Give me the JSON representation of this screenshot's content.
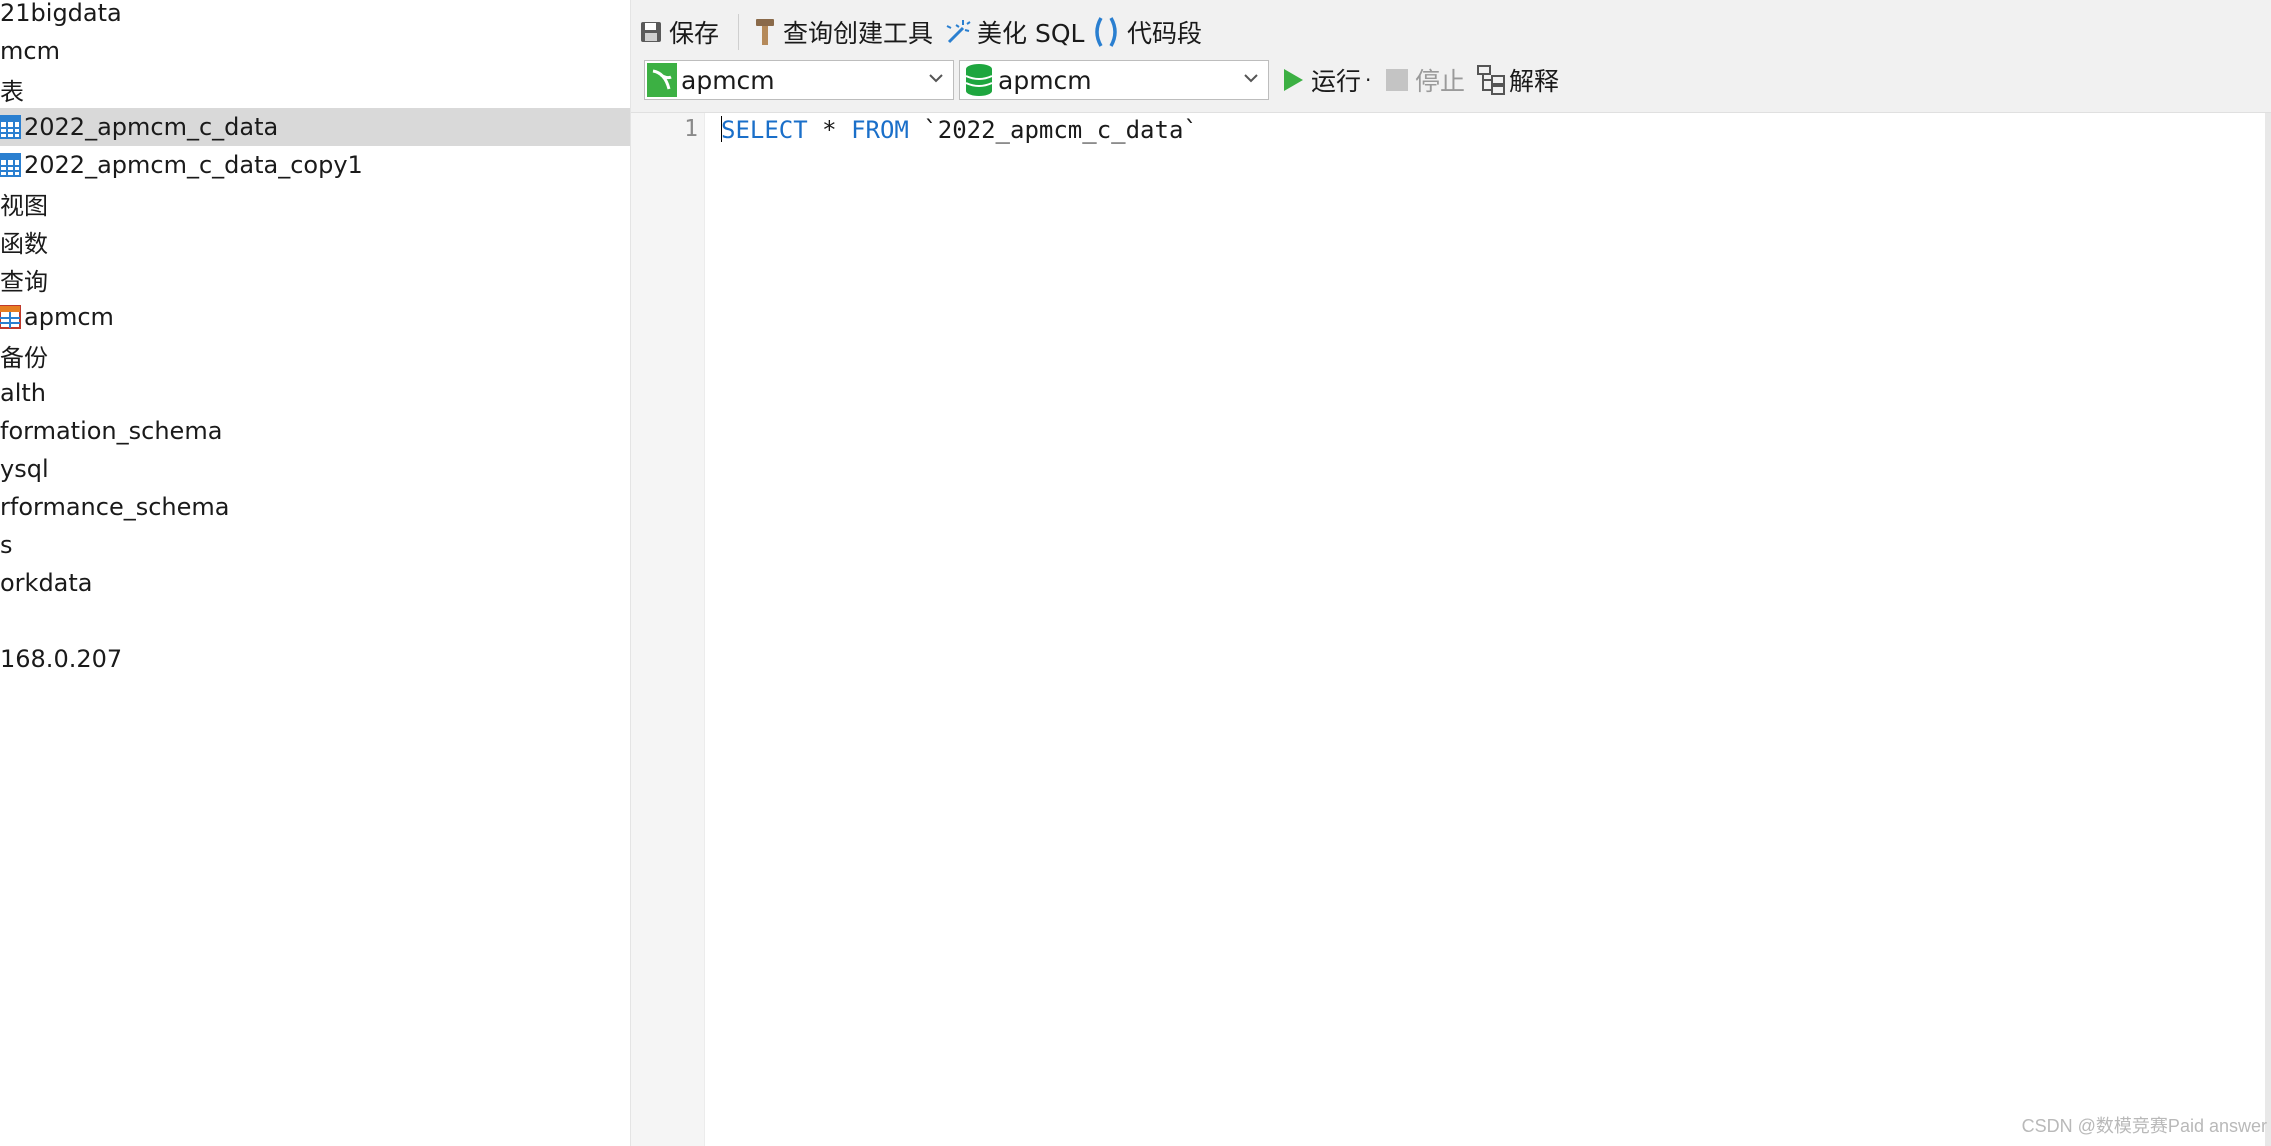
{
  "sidebar": {
    "items": [
      {
        "label": "21bigdata",
        "icon": "none"
      },
      {
        "label": "mcm",
        "icon": "none"
      },
      {
        "label": "表",
        "icon": "none"
      },
      {
        "label": "2022_apmcm_c_data",
        "icon": "table-icon",
        "selected": true
      },
      {
        "label": "2022_apmcm_c_data_copy1",
        "icon": "table-icon"
      },
      {
        "label": "视图",
        "icon": "none"
      },
      {
        "label": "函数",
        "icon": "none"
      },
      {
        "label": "查询",
        "icon": "none"
      },
      {
        "label": "apmcm",
        "icon": "query-icon"
      },
      {
        "label": "备份",
        "icon": "none"
      },
      {
        "label": "alth",
        "icon": "none"
      },
      {
        "label": "formation_schema",
        "icon": "none"
      },
      {
        "label": "ysql",
        "icon": "none"
      },
      {
        "label": "rformance_schema",
        "icon": "none"
      },
      {
        "label": "s",
        "icon": "none"
      },
      {
        "label": "orkdata",
        "icon": "none"
      },
      {
        "label": "168.0.207",
        "icon": "none"
      }
    ]
  },
  "toolbar": {
    "save_label": "保存",
    "query_builder_label": "查询创建工具",
    "beautify_label": "美化 SQL",
    "snippet_label": "代码段",
    "connection_value": "apmcm",
    "database_value": "apmcm",
    "run_label": "运行",
    "stop_label": "停止",
    "explain_label": "解释"
  },
  "editor": {
    "line_number": "1",
    "tokens": [
      {
        "text": "SELECT",
        "kind": "kw"
      },
      {
        "text": " * ",
        "kind": "plain"
      },
      {
        "text": "FROM",
        "kind": "kw"
      },
      {
        "text": " `2022_apmcm_c_data`",
        "kind": "plain"
      }
    ]
  },
  "watermark": "CSDN @数模竞赛Paid answer",
  "colors": {
    "keyword": "#1a6fc9",
    "selection": "#d9d9d9",
    "run_green": "#3cb043",
    "db_green": "#1ea63f"
  }
}
